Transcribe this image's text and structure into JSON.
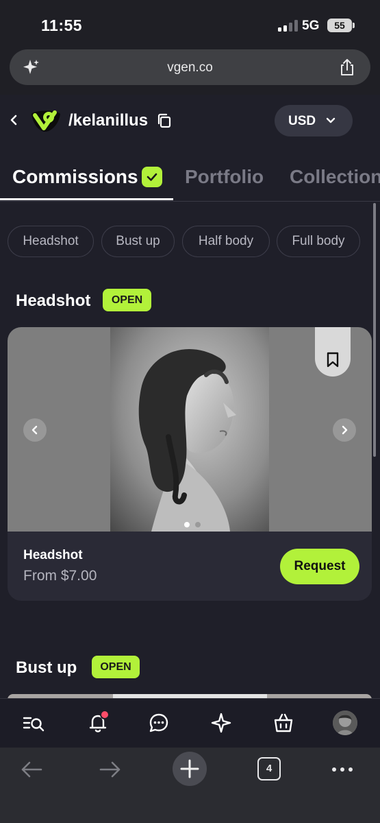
{
  "status_bar": {
    "time": "11:55",
    "network": "5G",
    "battery": "55"
  },
  "browser": {
    "url": "vgen.co",
    "tabs_count": "4"
  },
  "header": {
    "handle": "/kelanillus",
    "currency": "USD"
  },
  "tabs": [
    {
      "label": "Commissions",
      "active": true
    },
    {
      "label": "Portfolio",
      "active": false
    },
    {
      "label": "Collection",
      "active": false
    }
  ],
  "chips": [
    "Headshot",
    "Bust up",
    "Half body",
    "Full body"
  ],
  "sections": [
    {
      "title": "Headshot",
      "badge": "OPEN",
      "card": {
        "title": "Headshot",
        "price": "From $7.00",
        "button": "Request",
        "slides_total": 2,
        "slide_active": 1
      }
    },
    {
      "title": "Bust up",
      "badge": "OPEN"
    }
  ],
  "colors": {
    "accent": "#b2f13a",
    "background": "#1f1f29",
    "card": "#2a2a36",
    "notification": "#ff4d6a"
  },
  "icons": {
    "app_nav": [
      "browse-icon",
      "bell-icon",
      "chat-icon",
      "sparkle-icon",
      "bag-icon",
      "avatar"
    ],
    "browser_nav": [
      "back-arrow-icon",
      "forward-arrow-icon",
      "plus-icon",
      "tabs-icon",
      "more-icon"
    ]
  }
}
